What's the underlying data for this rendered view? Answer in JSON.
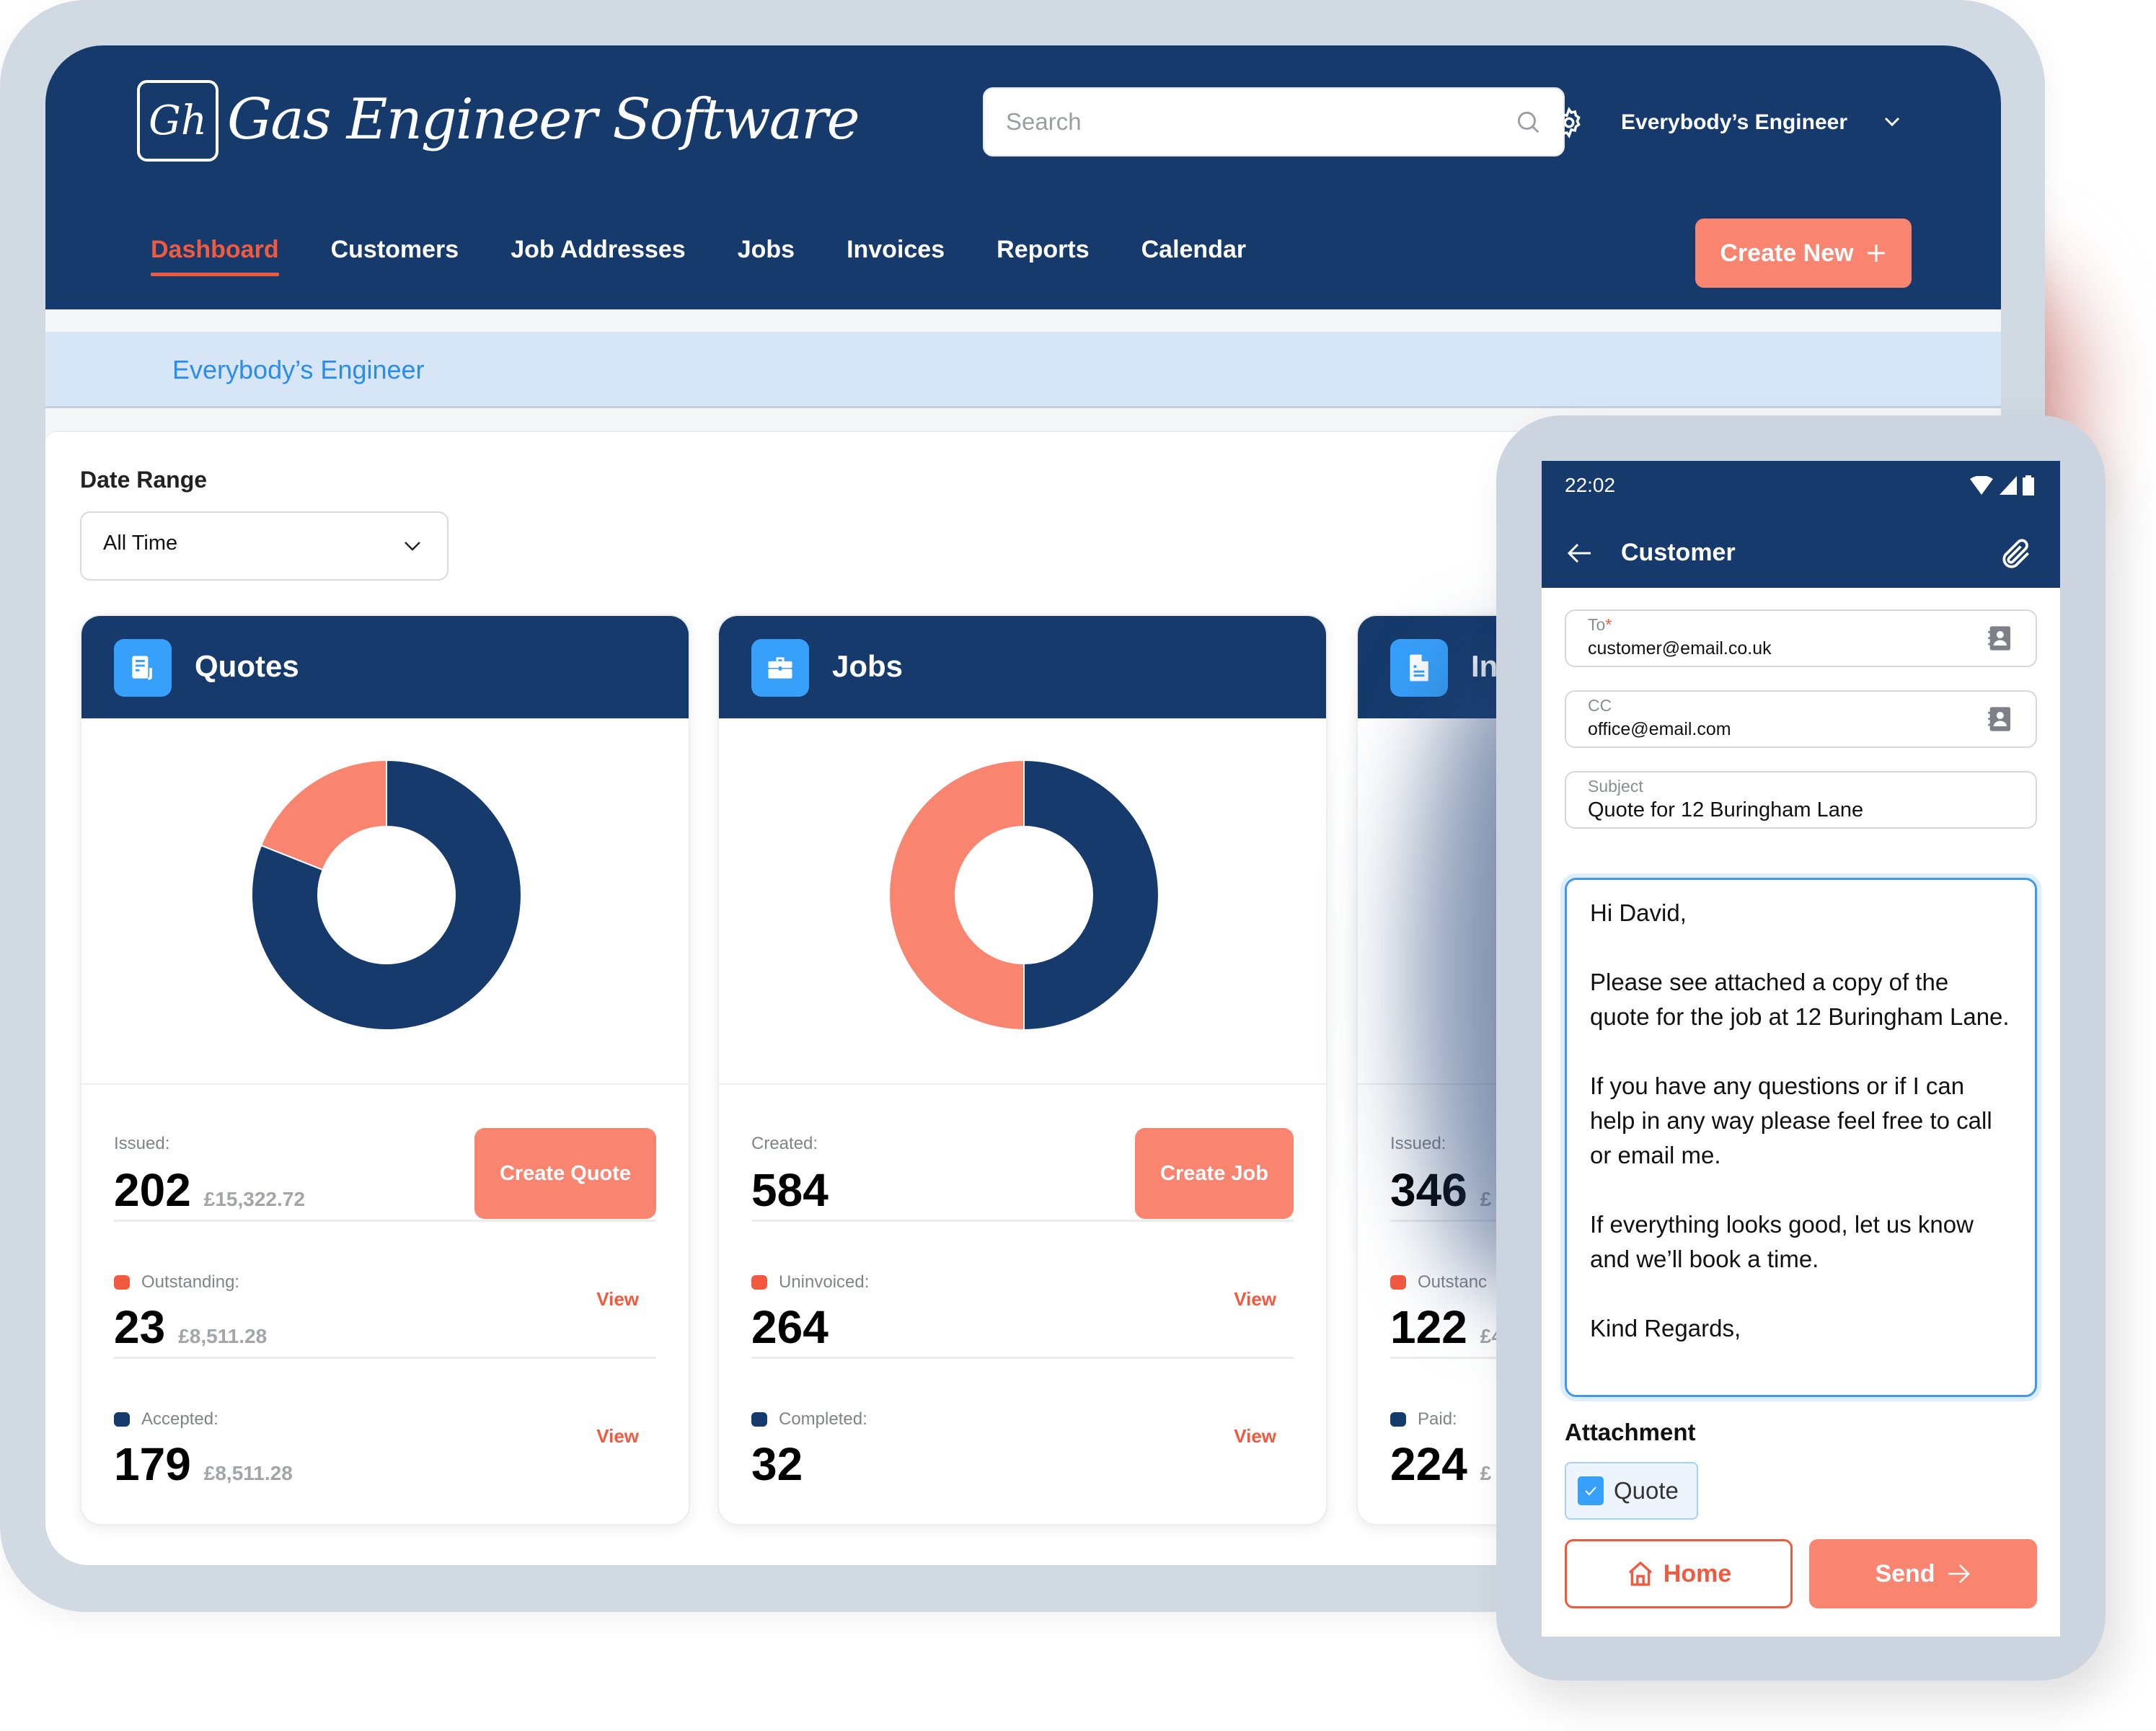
{
  "brand": {
    "logo_mark": "Gh",
    "name": "Gas Engineer Software"
  },
  "header": {
    "search_placeholder": "Search",
    "account_name": "Everybody’s Engineer",
    "nav": [
      {
        "label": "Dashboard",
        "active": true
      },
      {
        "label": "Customers",
        "active": false
      },
      {
        "label": "Job Addresses",
        "active": false
      },
      {
        "label": "Jobs",
        "active": false
      },
      {
        "label": "Invoices",
        "active": false
      },
      {
        "label": "Reports",
        "active": false
      },
      {
        "label": "Calendar",
        "active": false
      }
    ],
    "create_new_label": "Create New",
    "icons": {
      "search": "search-icon",
      "settings": "gear-icon",
      "dropdown": "chevron-down-icon",
      "create": "plus-icon"
    }
  },
  "breadcrumb": "Everybody’s Engineer",
  "filters": {
    "date_range_label": "Date Range",
    "date_range_value": "All Time"
  },
  "colors": {
    "navy": "#153a6b",
    "accent": "#f98571",
    "accent_text": "#f25a3f",
    "icon_blue": "#37a0fb",
    "link_blue": "#2a8cec"
  },
  "cards": [
    {
      "title": "Quotes",
      "icon": "quote-document-icon",
      "button_label": "Create Quote",
      "primary": {
        "label": "Issued:",
        "count": "202",
        "amount": "£15,322.72"
      },
      "rows": [
        {
          "label": "Outstanding:",
          "color": "#f25a3f",
          "count": "23",
          "amount": "£8,511.28",
          "link": "View"
        },
        {
          "label": "Accepted:",
          "color": "#153a6b",
          "count": "179",
          "amount": "£8,511.28",
          "link": "View"
        }
      ]
    },
    {
      "title": "Jobs",
      "icon": "briefcase-icon",
      "button_label": "Create Job",
      "primary": {
        "label": "Created:",
        "count": "584",
        "amount": ""
      },
      "rows": [
        {
          "label": "Uninvoiced:",
          "color": "#f25a3f",
          "count": "264",
          "amount": "",
          "link": "View"
        },
        {
          "label": "Completed:",
          "color": "#153a6b",
          "count": "32",
          "amount": "",
          "link": "View"
        }
      ]
    },
    {
      "title": "In",
      "icon": "invoice-document-icon",
      "button_label": "",
      "primary": {
        "label": "Issued:",
        "count": "346",
        "amount": "£"
      },
      "rows": [
        {
          "label": "Outstanc",
          "color": "#f25a3f",
          "count": "122",
          "amount": "£4",
          "link": ""
        },
        {
          "label": "Paid:",
          "color": "#153a6b",
          "count": "224",
          "amount": "£",
          "link": ""
        }
      ]
    }
  ],
  "chart_data": [
    {
      "type": "pie",
      "title": "Quotes",
      "donut": true,
      "categories": [
        "Outstanding",
        "Accepted"
      ],
      "values": [
        19,
        81
      ],
      "unit": "percent of ring (estimated visually)",
      "colors": [
        "#f98571",
        "#153a6b"
      ]
    },
    {
      "type": "pie",
      "title": "Jobs",
      "donut": true,
      "categories": [
        "Uninvoiced",
        "Completed"
      ],
      "values": [
        50,
        50
      ],
      "unit": "percent of ring (estimated visually)",
      "colors": [
        "#f98571",
        "#153a6b"
      ]
    }
  ],
  "phone": {
    "status_time": "22:02",
    "appbar_title": "Customer",
    "to_label": "To",
    "to_required": "*",
    "to_value": "customer@email.co.uk",
    "cc_label": "CC",
    "cc_value": "office@email.com",
    "subject_label": "Subject",
    "subject_value": "Quote for 12 Buringham Lane",
    "body": "Hi David,\n\nPlease see attached a copy of the quote for the job at 12 Buringham Lane.\n\nIf you have any questions or if I can help in any way please feel free to call or email me.\n\nIf everything looks good, let us know and we’ll book a time.\n\nKind Regards,",
    "attachment_label": "Attachment",
    "attachment_item": "Quote",
    "attachment_checked": true,
    "home_label": "Home",
    "send_label": "Send"
  }
}
